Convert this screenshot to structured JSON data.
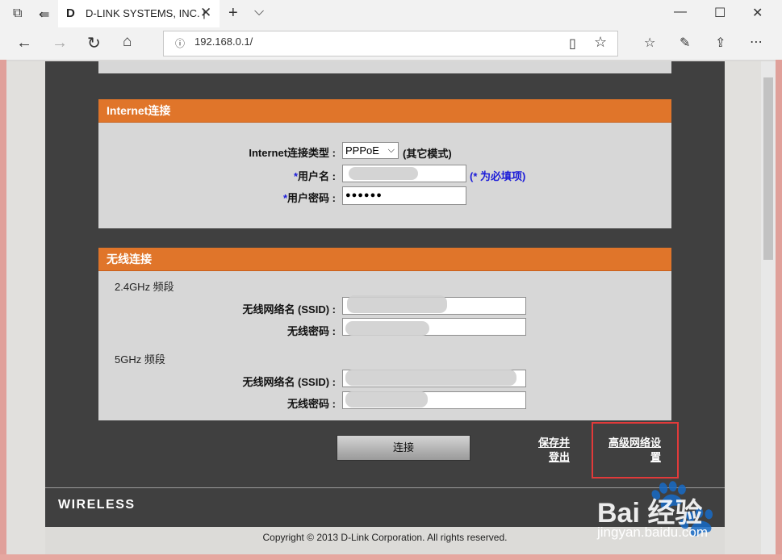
{
  "browser": {
    "tab_logo": "D",
    "tab_title": "D-LINK SYSTEMS, INC. |",
    "address": "192.168.0.1/"
  },
  "internet_section": {
    "title": "Internet连接",
    "conn_type_label": "Internet连接类型 :",
    "conn_type_value": "PPPoE",
    "conn_type_note": "(其它模式)",
    "username_label": "用户名 :",
    "required_note": "(* 为必填项)",
    "password_label": "用户密码 :",
    "password_mask": "●●●●●●",
    "asterisk": "*"
  },
  "wireless_section": {
    "title": "无线连接",
    "band_24": "2.4GHz 频段",
    "band_5": "5GHz 频段",
    "ssid_label": "无线网络名 (SSID) :",
    "pwd_label": "无线密码 :"
  },
  "actions": {
    "connect": "连接",
    "save_logout_line1": "保存并",
    "save_logout_line2": "登出",
    "advanced_line1": "高级网络设",
    "advanced_line2": "置"
  },
  "footer": {
    "brand": "WIRELESS",
    "copyright": "Copyright © 2013 D-Link Corporation. All rights reserved."
  },
  "watermark": {
    "brand": "Bai 经验",
    "url": "jingyan.baidu.com"
  }
}
